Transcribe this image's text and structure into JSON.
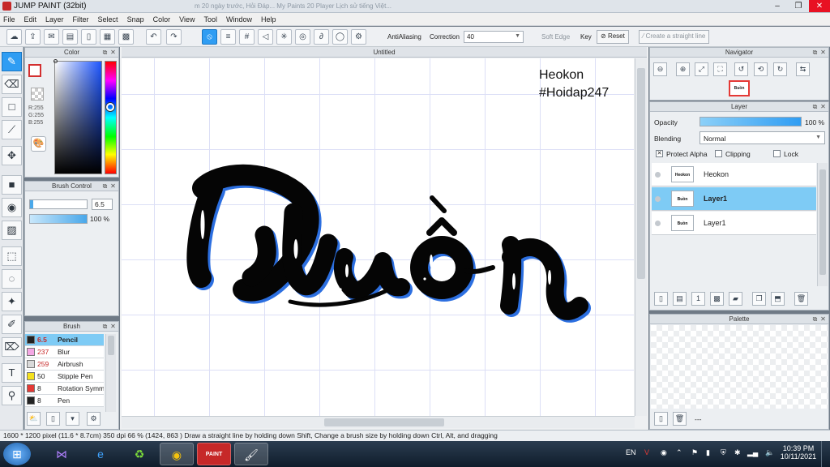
{
  "window": {
    "title": "JUMP PAINT (32bit)",
    "min": "–",
    "max": "❐",
    "close": "✕",
    "background_tabs": "m 20 ngày trước, Hỏi Đáp...   My Paints   20 Player   Lịch sử tiếng Việt..."
  },
  "menu": [
    "File",
    "Edit",
    "Layer",
    "Filter",
    "Select",
    "Snap",
    "Color",
    "View",
    "Tool",
    "Window",
    "Help"
  ],
  "toolbar": {
    "antialiasing_label": "AntiAliasing",
    "correction_label": "Correction",
    "correction_value": "40",
    "soft_edge_label": "Soft Edge",
    "key_label": "Key",
    "reset_label": "Reset",
    "straight_line_label": "Create a straight line"
  },
  "color_panel": {
    "title": "Color",
    "r": "R:255",
    "g": "G:255",
    "b": "B:255"
  },
  "brush_control": {
    "title": "Brush Control",
    "size_value": "6.5",
    "opacity_value": "100 %"
  },
  "brush_panel": {
    "title": "Brush",
    "items": [
      {
        "size": "6.5",
        "name": "Pencil",
        "color": "#222222"
      },
      {
        "size": "237",
        "name": "Blur",
        "color": "#f4a7e4"
      },
      {
        "size": "259",
        "name": "Airbrush",
        "color": "#d9d9d9"
      },
      {
        "size": "50",
        "name": "Stipple Pen",
        "color": "#f5e11e"
      },
      {
        "size": "8",
        "name": "Rotation Symmetry",
        "color": "#e53935"
      },
      {
        "size": "8",
        "name": "Pen",
        "color": "#222222"
      }
    ]
  },
  "document": {
    "tab_title": "Untitled",
    "watermark_line1": "Heokon",
    "watermark_line2": "#Hoidap247",
    "art_text": "Buồn"
  },
  "navigator": {
    "title": "Navigator",
    "thumb_text": "Buồn"
  },
  "layer_panel": {
    "title": "Layer",
    "opacity_label": "Opacity",
    "opacity_value": "100 %",
    "blending_label": "Blending",
    "blending_value": "Normal",
    "protect_alpha_label": "Protect Alpha",
    "clipping_label": "Clipping",
    "lock_label": "Lock",
    "layers": [
      {
        "name": "Heokon",
        "thumb": "Heokon #Hoidap247"
      },
      {
        "name": "Layer1",
        "thumb": "Buồn"
      },
      {
        "name": "Layer1",
        "thumb": "Buồn"
      }
    ],
    "selected_index": 1
  },
  "palette": {
    "title": "Palette",
    "footer_text": "---"
  },
  "status": {
    "text": "1600 * 1200 pixel   (11.6 * 8.7cm)   350 dpi   66 %   (1424, 863 )   Draw a straight line by holding down Shift, Change a brush size by holding down Ctrl, Alt, and dragging"
  },
  "taskbar": {
    "lang": "EN",
    "time": "10:39 PM",
    "date": "10/11/2021"
  },
  "colors": {
    "accent": "#2f9df3",
    "selected_row": "#7ecbf5",
    "taskbar": "#1b2b3b"
  }
}
